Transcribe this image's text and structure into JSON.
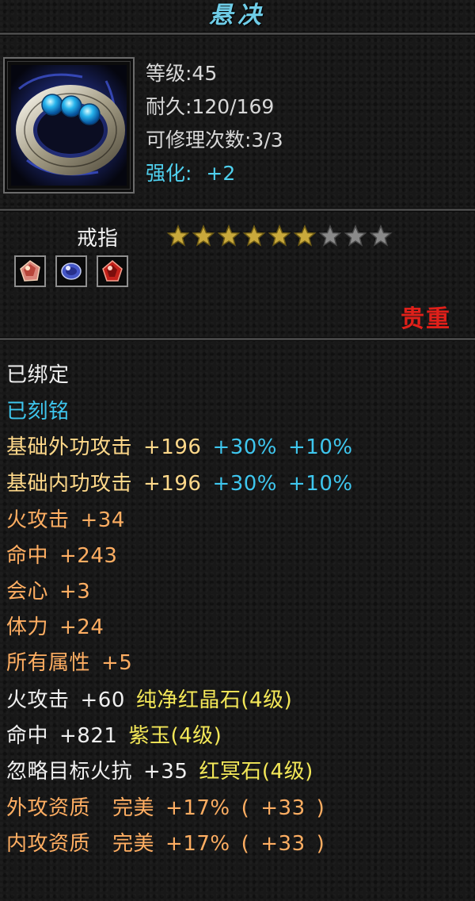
{
  "title": "悬决",
  "header": {
    "level": "等级:45",
    "durability": "耐久:120/169",
    "repairs": "可修理次数:3/3",
    "enhance_label": "强化:",
    "enhance_value": "+2"
  },
  "item": {
    "type": "戒指",
    "stars_filled": 6,
    "stars_total": 9,
    "rarity": "贵重",
    "gems": [
      "red-gem-icon",
      "blue-gem-icon",
      "crimson-gem-icon"
    ]
  },
  "status": {
    "bound": "已绑定",
    "engraved": "已刻铭"
  },
  "attributes": [
    {
      "name": "基础外功攻击",
      "value": "+196",
      "b1": "+30%",
      "b2": "+10%"
    },
    {
      "name": "基础内功攻击",
      "value": "+196",
      "b1": "+30%",
      "b2": "+10%"
    }
  ],
  "bonus_stats": [
    {
      "name": "火攻击",
      "value": "+34"
    },
    {
      "name": "命中",
      "value": "+243"
    },
    {
      "name": "会心",
      "value": "+3"
    },
    {
      "name": "体力",
      "value": "+24"
    },
    {
      "name": "所有属性",
      "value": "+5"
    }
  ],
  "gem_stats": [
    {
      "name": "火攻击",
      "value": "+60",
      "gem": "纯净红晶石(4级)"
    },
    {
      "name": "命中",
      "value": "+821",
      "gem": "紫玉(4级)"
    },
    {
      "name": "忽略目标火抗",
      "value": "+35",
      "gem": "红冥石(4级)"
    }
  ],
  "aptitude": [
    {
      "name": "外攻资质",
      "grade": "完美",
      "pct": "+17%",
      "open": "(",
      "bonus": "+33",
      "close": ")"
    },
    {
      "name": "内攻资质",
      "grade": "完美",
      "pct": "+17%",
      "open": "(",
      "bonus": "+33",
      "close": ")"
    }
  ],
  "colors": {
    "title": "#6fcde8",
    "cyan": "#3ec6ee",
    "gold": "#ffd98a",
    "orange": "#ffae62",
    "green": "#5ee34d",
    "rarity": "#e0201a"
  }
}
